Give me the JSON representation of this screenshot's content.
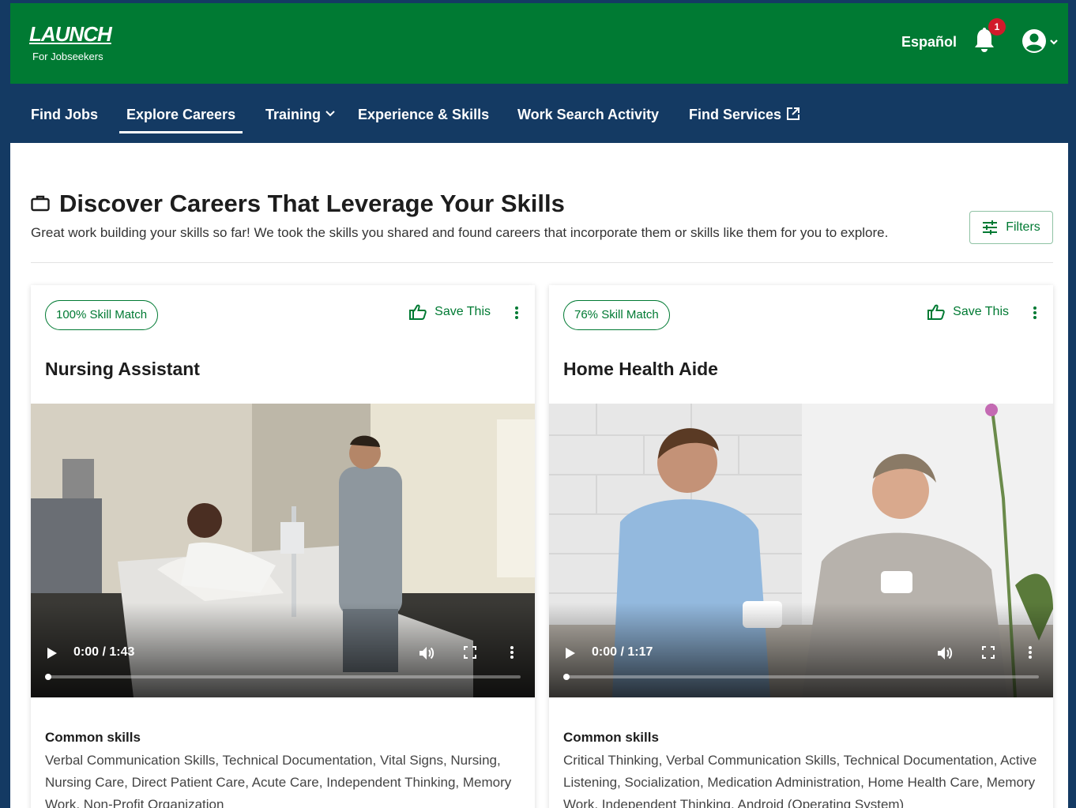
{
  "header": {
    "logo_word": "LAUNCH",
    "logo_sub": "For Jobseekers",
    "language_link": "Español",
    "notification_count": "1",
    "icons": [
      "bell-icon",
      "account-circle-icon",
      "chevron-down-icon"
    ]
  },
  "nav": {
    "items": [
      {
        "label": "Find Jobs",
        "active": false
      },
      {
        "label": "Explore Careers",
        "active": true
      },
      {
        "label": "Training",
        "active": false,
        "dropdown": true
      },
      {
        "label": "Experience & Skills",
        "active": false
      },
      {
        "label": "Work Search Activity",
        "active": false
      },
      {
        "label": "Find Services",
        "active": false,
        "external": true
      }
    ]
  },
  "page": {
    "title": "Discover Careers That Leverage Your Skills",
    "subtitle": "Great work building your skills so far! We took the skills you shared and found careers that incorporate them or skills like them for you to explore.",
    "filters_label": "Filters"
  },
  "cards": [
    {
      "match": "100% Skill Match",
      "save_label": "Save This",
      "title": "Nursing Assistant",
      "video_time": "0:00 / 1:43",
      "video_progress": 0,
      "skills_heading": "Common skills",
      "skills": "Verbal Communication Skills, Technical Documentation, Vital Signs, Nursing, Nursing Care, Direct Patient Care, Acute Care, Independent Thinking, Memory Work, Non-Profit Organization"
    },
    {
      "match": "76% Skill Match",
      "save_label": "Save This",
      "title": "Home Health Aide",
      "video_time": "0:00 / 1:17",
      "video_progress": 0,
      "skills_heading": "Common skills",
      "skills": "Critical Thinking, Verbal Communication Skills, Technical Documentation, Active Listening, Socialization, Medication Administration, Home Health Care, Memory Work, Independent Thinking, Android (Operating System)"
    }
  ],
  "colors": {
    "brand_green": "#007a33",
    "nav_navy": "#143a63",
    "badge_red": "#d11a2a"
  }
}
